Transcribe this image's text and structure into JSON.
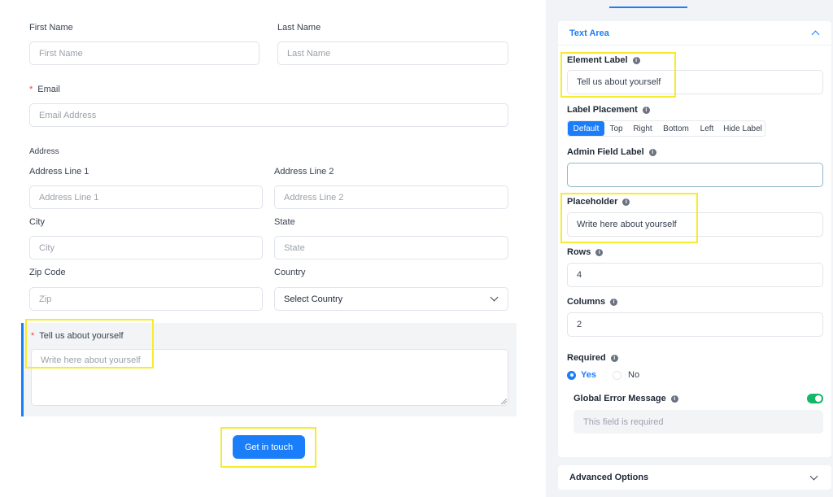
{
  "form": {
    "first_name": {
      "label": "First Name",
      "placeholder": "First Name"
    },
    "last_name": {
      "label": "Last Name",
      "placeholder": "Last Name"
    },
    "email": {
      "required_mark": "*",
      "label": "Email",
      "placeholder": "Email Address"
    },
    "address": {
      "section_label": "Address",
      "line1": {
        "label": "Address Line 1",
        "placeholder": "Address Line 1"
      },
      "line2": {
        "label": "Address Line 2",
        "placeholder": "Address Line 2"
      },
      "city": {
        "label": "City",
        "placeholder": "City"
      },
      "state": {
        "label": "State",
        "placeholder": "State"
      },
      "zip": {
        "label": "Zip Code",
        "placeholder": "Zip"
      },
      "country": {
        "label": "Country",
        "selected": "Select Country"
      }
    },
    "textarea": {
      "required_mark": "*",
      "label": "Tell us about yourself",
      "placeholder": "Write here about yourself"
    },
    "submit_label": "Get in touch"
  },
  "settings": {
    "section_title": "Text Area",
    "element_label": {
      "label": "Element Label",
      "value": "Tell us about yourself"
    },
    "label_placement": {
      "label": "Label Placement",
      "options": [
        "Default",
        "Top",
        "Right",
        "Bottom",
        "Left",
        "Hide Label"
      ],
      "selected": "Default"
    },
    "admin_field_label": {
      "label": "Admin Field Label",
      "value": ""
    },
    "placeholder": {
      "label": "Placeholder",
      "value": "Write here about yourself"
    },
    "rows": {
      "label": "Rows",
      "value": "4"
    },
    "columns": {
      "label": "Columns",
      "value": "2"
    },
    "required": {
      "label": "Required",
      "options": [
        "Yes",
        "No"
      ],
      "selected": "Yes"
    },
    "global_error": {
      "label": "Global Error Message",
      "enabled": true,
      "placeholder": "This field is required"
    },
    "advanced_title": "Advanced Options"
  },
  "colors": {
    "accent": "#1a7efb",
    "highlight": "#f5ec2f",
    "toggle": "#12b76a",
    "required": "#ef4444"
  },
  "icons": [
    "chevron-up-icon",
    "chevron-down-icon",
    "info-icon",
    "resize-handle-icon"
  ]
}
